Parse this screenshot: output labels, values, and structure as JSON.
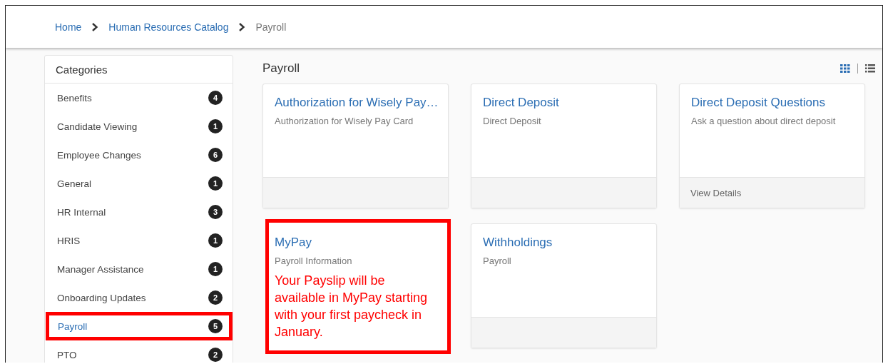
{
  "breadcrumb": [
    {
      "label": "Home",
      "kind": "link"
    },
    {
      "label": "Human Resources Catalog",
      "kind": "link"
    },
    {
      "label": "Payroll",
      "kind": "current"
    }
  ],
  "sidebar": {
    "title": "Categories",
    "items": [
      {
        "label": "Benefits",
        "count": "4",
        "selected": false,
        "highlighted": false
      },
      {
        "label": "Candidate Viewing",
        "count": "1",
        "selected": false,
        "highlighted": false
      },
      {
        "label": "Employee Changes",
        "count": "6",
        "selected": false,
        "highlighted": false
      },
      {
        "label": "General",
        "count": "1",
        "selected": false,
        "highlighted": false
      },
      {
        "label": "HR Internal",
        "count": "3",
        "selected": false,
        "highlighted": false
      },
      {
        "label": "HRIS",
        "count": "1",
        "selected": false,
        "highlighted": false
      },
      {
        "label": "Manager Assistance",
        "count": "1",
        "selected": false,
        "highlighted": false
      },
      {
        "label": "Onboarding Updates",
        "count": "2",
        "selected": false,
        "highlighted": false
      },
      {
        "label": "Payroll",
        "count": "5",
        "selected": true,
        "highlighted": true
      },
      {
        "label": "PTO",
        "count": "2",
        "selected": false,
        "highlighted": false
      }
    ]
  },
  "content": {
    "title": "Payroll",
    "view_toggle": [
      {
        "kind": "grid",
        "selected": true
      },
      {
        "kind": "list",
        "selected": false
      }
    ],
    "cards": [
      {
        "title": "Authorization for Wisely Pay…",
        "description": "Authorization for Wisely Pay Card",
        "highlighted": false
      },
      {
        "title": "Direct Deposit",
        "description": "Direct Deposit",
        "highlighted": false
      },
      {
        "title": "Direct Deposit Questions",
        "description": "Ask a question about direct deposit",
        "footer": "View Details",
        "highlighted": false
      },
      {
        "title": "MyPay",
        "description": "Payroll Information",
        "highlighted": true,
        "annotation": "Your Payslip will be available in MyPay starting with your first paycheck in January."
      },
      {
        "title": "Withholdings",
        "description": "Payroll",
        "highlighted": false
      }
    ]
  }
}
